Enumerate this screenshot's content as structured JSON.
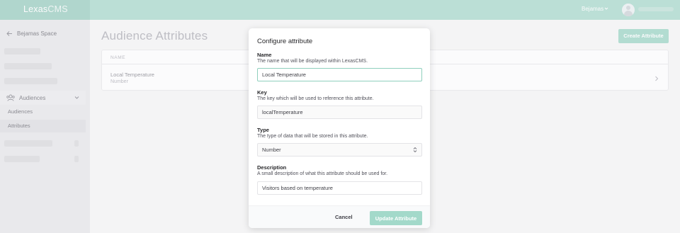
{
  "app": {
    "logo_main": "Lexas",
    "logo_sub": "CMS",
    "workspace": "Bejamas"
  },
  "sidebar": {
    "back_label": "Bejamas Space",
    "group_label": "Audiences",
    "items": [
      {
        "label": "Audiences",
        "active": false
      },
      {
        "label": "Attributes",
        "active": true
      }
    ]
  },
  "main": {
    "title": "Audience Attributes",
    "create_label": "Create Attribute",
    "table": {
      "column_name": "NAME",
      "rows": [
        {
          "name": "Local Temperature",
          "type": "Number"
        }
      ]
    }
  },
  "modal": {
    "title": "Configure attribute",
    "fields": {
      "name": {
        "label": "Name",
        "description": "The name that will be displayed within LexasCMS.",
        "value": "Local Temperature"
      },
      "key": {
        "label": "Key",
        "description": "The key which will be used to reference this attribute.",
        "value": "localTemperature"
      },
      "type": {
        "label": "Type",
        "description": "The type of data that will be stored in this attribute.",
        "value": "Number"
      },
      "description": {
        "label": "Description",
        "description": "A small description of what this attribute should be used for.",
        "value": "Visitors based on temperature"
      }
    },
    "cancel_label": "Cancel",
    "update_label": "Update Attribute"
  },
  "colors": {
    "topbar": "#9dd4c5",
    "accent": "#8fcfbd",
    "sidebar": "#e4e4e7"
  },
  "icons": [
    "arrow-left-icon",
    "users-icon",
    "chevron-down-icon",
    "chevron-right-icon",
    "avatar-icon",
    "select-arrows-icon"
  ]
}
